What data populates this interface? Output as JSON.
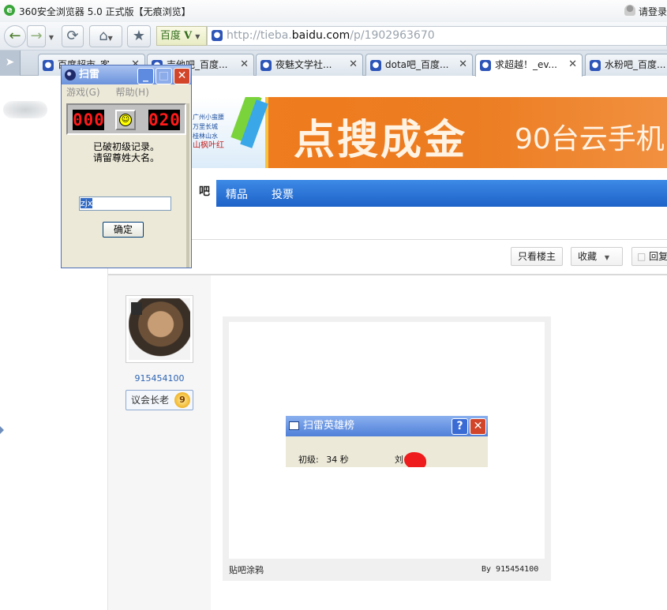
{
  "browser": {
    "title": "360安全浏览器 5.0 正式版【无痕浏览】",
    "login_link": "请登录",
    "search_engine": "百度",
    "url_prefix": "http://tieba.",
    "url_host": "baidu.com",
    "url_path": "/p/1902963670"
  },
  "tabs": [
    {
      "label": "百度超市_客"
    },
    {
      "label": "吉他吧_百度..."
    },
    {
      "label": "夜魅文学社..."
    },
    {
      "label": "dota吧_百度..."
    },
    {
      "label": "求超越！_ev...",
      "active": true
    },
    {
      "label": "水粉吧_百度..."
    }
  ],
  "banner": {
    "headline": "点搜成金",
    "subline": "90台云手机",
    "promo_lines": [
      "广州小蛮腰",
      "万里长城",
      "桂林山水",
      "山枫叶红"
    ]
  },
  "forum_nav": {
    "current": "吧",
    "links": [
      "精品",
      "投票"
    ]
  },
  "thread_actions": {
    "only_author": "只看楼主",
    "favorite": "收藏",
    "reply": "回复"
  },
  "author": {
    "username": "915454100",
    "rank_title": "议会长老",
    "level": "9"
  },
  "doodle": {
    "footer_left": "贴吧涂鸦",
    "footer_right": "By 915454100",
    "hall_of_fame": {
      "title": "扫雷英雄榜",
      "help_btn": "?",
      "row_label": "初级:",
      "row_time": "34 秒",
      "row_name": "刘"
    }
  },
  "minesweeper": {
    "title": "扫雷",
    "menu": [
      "游戏(G)",
      "帮助(H)"
    ],
    "mine_counter": "000",
    "timer": "020",
    "message_line1": "已破初级记录。",
    "message_line2": "请留尊姓大名。",
    "name_value": "zjx",
    "ok_button": "确定"
  },
  "colors": {
    "accent_blue": "#1e62c8",
    "banner_orange": "#f07b1c",
    "led_red": "#ff1a1a"
  }
}
